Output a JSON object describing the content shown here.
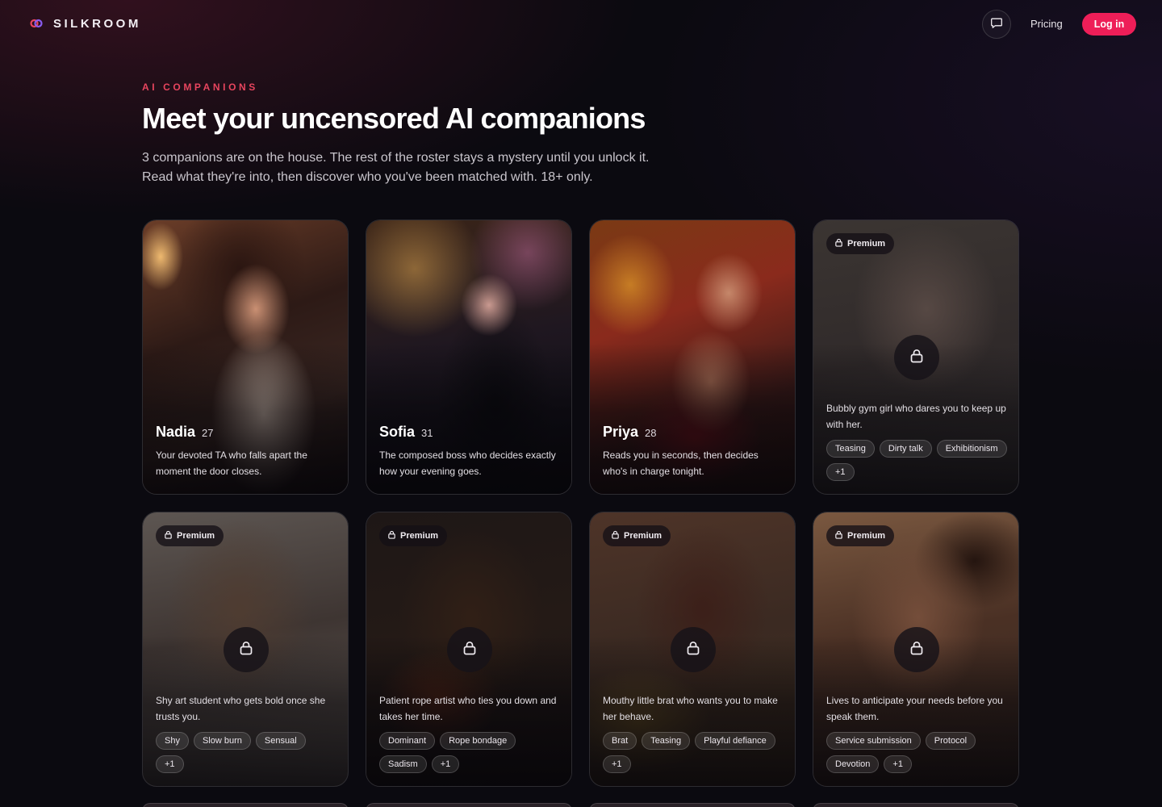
{
  "brand": {
    "name": "SILKROOM"
  },
  "nav": {
    "pricing_label": "Pricing",
    "login_label": "Log in"
  },
  "hero": {
    "eyebrow": "AI COMPANIONS",
    "title": "Meet your uncensored AI companions",
    "subtitle_line1": "3 companions are on the house. The rest of the roster stays a mystery until you unlock it.",
    "subtitle_line2": "Read what they're into, then discover who you've been matched with. 18+ only."
  },
  "companions": [
    {
      "name": "Nadia",
      "age": "27",
      "desc": "Your devoted TA who falls apart the moment the door closes."
    },
    {
      "name": "Sofia",
      "age": "31",
      "desc": "The composed boss who decides exactly how your evening goes."
    },
    {
      "name": "Priya",
      "age": "28",
      "desc": "Reads you in seconds, then decides who's in charge tonight."
    }
  ],
  "locked": [
    {
      "badge": "Premium",
      "desc": "Bubbly gym girl who dares you to keep up with her.",
      "tags": [
        "Teasing",
        "Dirty talk",
        "Exhibitionism",
        "+1"
      ]
    },
    {
      "badge": "Premium",
      "desc": "Shy art student who gets bold once she trusts you.",
      "tags": [
        "Shy",
        "Slow burn",
        "Sensual",
        "+1"
      ]
    },
    {
      "badge": "Premium",
      "desc": "Patient rope artist who ties you down and takes her time.",
      "tags": [
        "Dominant",
        "Rope bondage",
        "Sadism",
        "+1"
      ]
    },
    {
      "badge": "Premium",
      "desc": "Mouthy little brat who wants you to make her behave.",
      "tags": [
        "Brat",
        "Teasing",
        "Playful defiance",
        "+1"
      ]
    },
    {
      "badge": "Premium",
      "desc": "Lives to anticipate your needs before you speak them.",
      "tags": [
        "Service submission",
        "Protocol",
        "Devotion",
        "+1"
      ]
    }
  ],
  "colors": {
    "accent": "#ee1e58",
    "eyebrow": "#e8455e",
    "background": "#0b0a10"
  },
  "icons": {
    "logo": "silkroom-logo-icon",
    "chat": "chat-bubble-icon",
    "lock": "lock-icon"
  }
}
